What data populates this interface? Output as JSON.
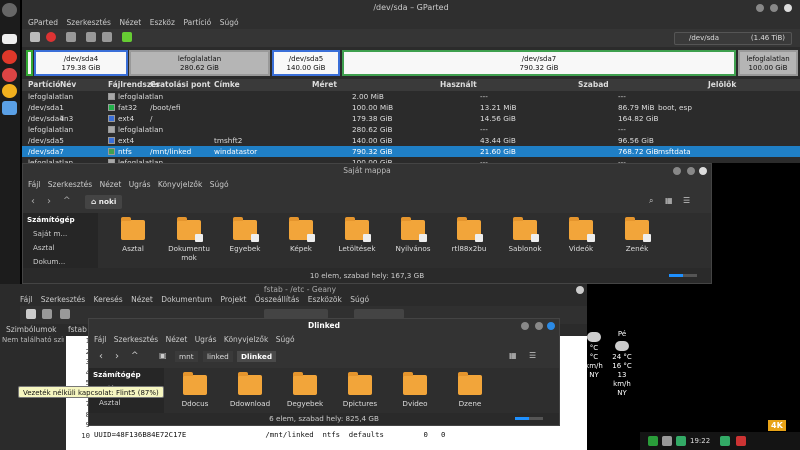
{
  "gparted": {
    "title": "/dev/sda – GParted",
    "menu": [
      "GParted",
      "Szerkesztés",
      "Nézet",
      "Eszköz",
      "Partíció",
      "Súgó"
    ],
    "device": "/dev/sda",
    "device_size": "(1.46 TiB)",
    "bar": [
      {
        "name": "/dev/sda4",
        "size": "179.38 GiB"
      },
      {
        "name": "lefoglalatlan",
        "size": "280.62 GiB"
      },
      {
        "name": "/dev/sda5",
        "size": "140.00 GiB"
      },
      {
        "name": "/dev/sda7",
        "size": "790.32 GiB"
      },
      {
        "name": "lefoglalatlan",
        "size": "100.00 GiB"
      }
    ],
    "headers": [
      "Partíció",
      "Név",
      "Fájlrendszer",
      "Csatolási pont",
      "Címke",
      "Méret",
      "Használt",
      "Szabad",
      "Jelölők"
    ],
    "rows": [
      {
        "part": "lefoglalatlan",
        "name": "",
        "fs": "lefoglalatlan",
        "mount": "",
        "label": "",
        "size": "2.00 MiB",
        "used": "---",
        "free": "---",
        "flags": "",
        "swatch": "#a8a8a8"
      },
      {
        "part": "/dev/sda1",
        "name": "",
        "fs": "fat32",
        "mount": "/boot/efi",
        "label": "",
        "size": "100.00 MiB",
        "used": "13.21 MiB",
        "free": "86.79 MiB",
        "flags": "boot, esp",
        "swatch": "#22b04a"
      },
      {
        "part": "/dev/sda4",
        "name": "lin3",
        "fs": "ext4",
        "mount": "/",
        "label": "",
        "size": "179.38 GiB",
        "used": "14.56 GiB",
        "free": "164.82 GiB",
        "flags": "",
        "swatch": "#3a6fd8"
      },
      {
        "part": "lefoglalatlan",
        "name": "",
        "fs": "lefoglalatlan",
        "mount": "",
        "label": "",
        "size": "280.62 GiB",
        "used": "---",
        "free": "---",
        "flags": "",
        "swatch": "#a8a8a8"
      },
      {
        "part": "/dev/sda5",
        "name": "",
        "fs": "ext4",
        "mount": "",
        "label": "tmshft2",
        "size": "140.00 GiB",
        "used": "43.44 GiB",
        "free": "96.56 GiB",
        "flags": "",
        "swatch": "#3a6fd8"
      },
      {
        "part": "/dev/sda7",
        "name": "",
        "fs": "ntfs",
        "mount": "/mnt/linked",
        "label": "windatastor",
        "size": "790.32 GiB",
        "used": "21.60 GiB",
        "free": "768.72 GiB",
        "flags": "msftdata",
        "swatch": "#3fa04f"
      },
      {
        "part": "lefoglalatlan",
        "name": "",
        "fs": "lefoglalatlan",
        "mount": "",
        "label": "",
        "size": "100.00 GiB",
        "used": "---",
        "free": "---",
        "flags": "",
        "swatch": "#a8a8a8"
      }
    ]
  },
  "nemo1": {
    "title": "Saját mappa",
    "menu": [
      "Fájl",
      "Szerkesztés",
      "Nézet",
      "Ugrás",
      "Könyvjelzők",
      "Súgó"
    ],
    "path": "noki",
    "sidebar": [
      "Számítógép",
      "Saját m...",
      "Asztal",
      "Dokum...",
      "..."
    ],
    "folders": [
      "Asztal",
      "Dokumentumok",
      "Egyebek",
      "Képek",
      "Letöltések",
      "Nyilvános",
      "rtl88x2bu",
      "Sablonok",
      "Videók",
      "Zenék"
    ],
    "status": "10 elem, szabad hely: 167,3 GB"
  },
  "geany": {
    "title": "fstab - /etc - Geany",
    "menu": [
      "Fájl",
      "Szerkesztés",
      "Keresés",
      "Nézet",
      "Dokumentum",
      "Projekt",
      "Összeállítás",
      "Eszközök",
      "Súgó"
    ],
    "tab_symbols": "Szimbólumok",
    "tab_file": "fstab",
    "no_symbols": "Nem található szimból...",
    "line10": "UUID=48F136B84E72C17E                  /mnt/linked  ntfs  defaults         0   0",
    "line9": "  # ..."
  },
  "nemo2": {
    "title": "Dlinked",
    "menu": [
      "Fájl",
      "Szerkesztés",
      "Nézet",
      "Ugrás",
      "Könyvjelzők",
      "Súgó"
    ],
    "crumbs": [
      "mnt",
      "linked",
      "Dlinked"
    ],
    "sidebar": [
      "Számítógép",
      "Saját m...",
      "Asztal"
    ],
    "folders": [
      "Ddocus",
      "Ddownload",
      "Degyebek",
      "Dpictures",
      "Dvideo",
      "Dzene"
    ],
    "status": "6 elem, szabad hely: 825,4 GB"
  },
  "weather": [
    {
      "day": "Pé",
      "t1": "24 °C",
      "t2": "16 °C",
      "wind": "13 km/h",
      "dir": "NY"
    },
    {
      "day": "",
      "t1": "°C",
      "t2": "°C",
      "wind": "km/h",
      "dir": "NY"
    }
  ],
  "tooltip": "Vezeték nélküli kapcsolat: Flint5 (87%)",
  "tray": {
    "time": "19:22",
    "badge": "4K"
  },
  "dock_numbers": [
    "22",
    "20"
  ]
}
